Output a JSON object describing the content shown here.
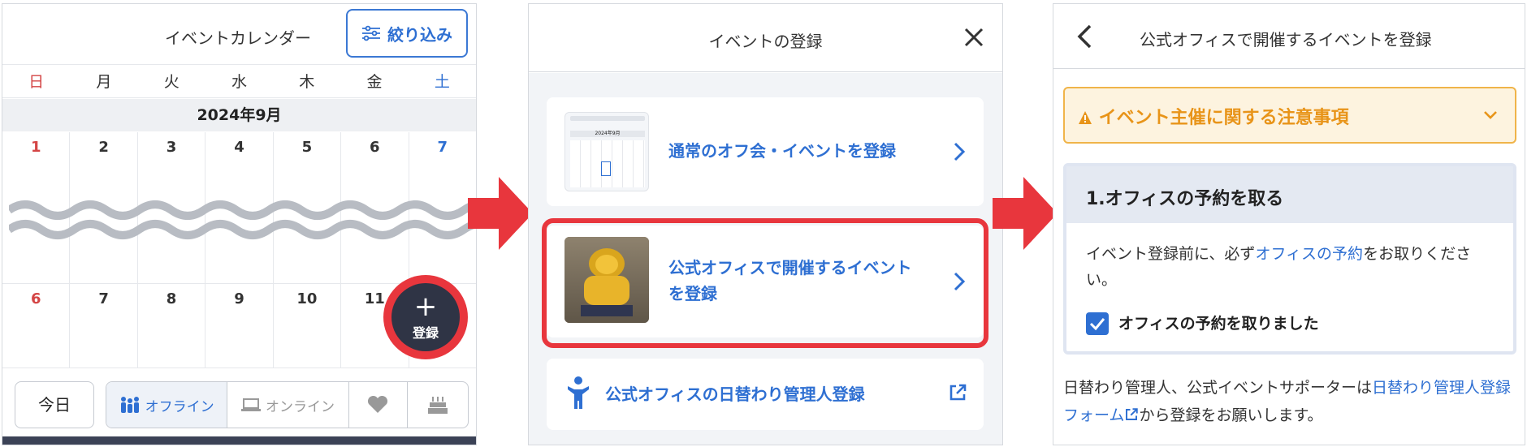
{
  "calendar": {
    "title": "イベントカレンダー",
    "filter_label": "絞り込み",
    "weekdays": [
      "日",
      "月",
      "火",
      "水",
      "木",
      "金",
      "土"
    ],
    "month": "2024年9月",
    "week1": [
      "1",
      "2",
      "3",
      "4",
      "5",
      "6",
      "7"
    ],
    "week2": [
      "6",
      "7",
      "8",
      "9",
      "10",
      "11",
      ""
    ],
    "fab_label": "登録",
    "today_label": "今日",
    "segments": {
      "offline": "オフライン",
      "online": "オンライン"
    }
  },
  "register_modal": {
    "title": "イベントの登録",
    "options": [
      {
        "label": "通常のオフ会・イベントを登録"
      },
      {
        "label_line1": "公式オフィスで開催するイベント",
        "label_line2": "を登録"
      },
      {
        "label": "公式オフィスの日替わり管理人登録"
      }
    ],
    "thumb_month": "2024年9月"
  },
  "official_event": {
    "title": "公式オフィスで開催するイベントを登録",
    "warning": "イベント主催に関する注意事項",
    "step_title": "1.オフィスの予約を取る",
    "step_text_pre": "イベント登録前に、必ず",
    "step_link": "オフィスの予約",
    "step_text_post": "をお取りください。",
    "checkbox_label": "オフィスの予約を取りました",
    "note_pre": "日替わり管理人、公式イベントサポーターは",
    "note_link": "日替わり管理人登録フォーム",
    "note_post": "から登録をお願いします。"
  },
  "colors": {
    "accent": "#2e6fd2",
    "highlight": "#e8363d",
    "warning": "#e89419"
  }
}
